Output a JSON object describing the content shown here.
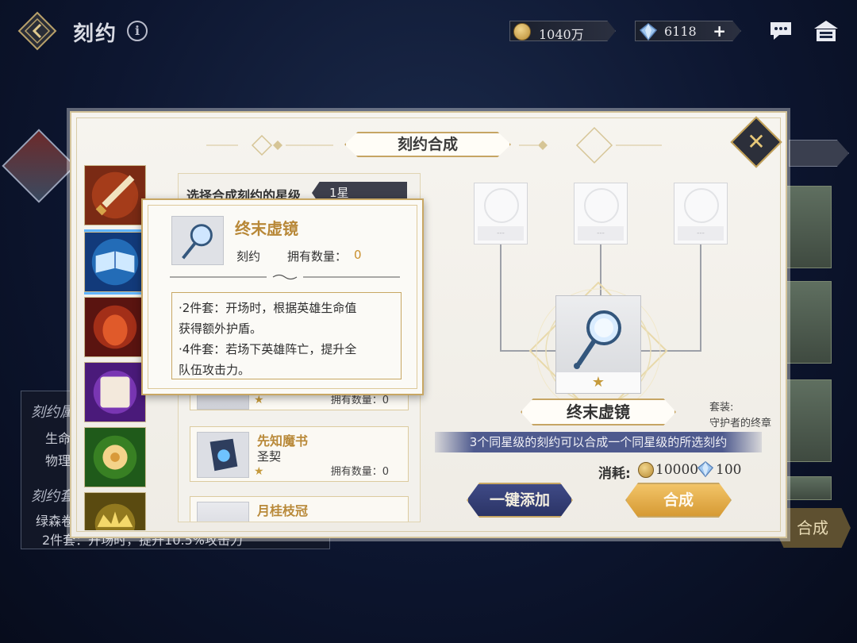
{
  "header": {
    "title": "刻约",
    "gold": "1040万",
    "gems": "6118",
    "icons": [
      "back-icon",
      "info-icon",
      "gold-coin-icon",
      "gem-icon",
      "plus-icon",
      "chat-icon",
      "home-icon"
    ]
  },
  "background": {
    "panel_title1": "刻约属",
    "panel_line1": "生命",
    "panel_line2": "物理",
    "panel_title2": "刻约套",
    "panel_line3": "绿森卷",
    "panel_line4": "2件套：开场时，提升10.5%攻击力",
    "hecheng_button": "合成"
  },
  "modal": {
    "title": "刻约合成",
    "close": "✕",
    "star_select_label": "选择合成刻约的星级",
    "star_select_value": "1星",
    "list": [
      {
        "name": "",
        "sub": "",
        "owned_label": "拥有数量：0",
        "stars": "★"
      },
      {
        "name": "先知魔书",
        "sub": "圣契",
        "owned_label": "拥有数量：0",
        "stars": "★"
      },
      {
        "name": "月桂枝冠",
        "sub": "",
        "owned_label": "",
        "stars": ""
      }
    ],
    "tooltip": {
      "name": "终末虚镜",
      "type": "刻约",
      "owned_label": "拥有数量：",
      "owned_value": "0",
      "desc_line1": "·2件套：开场时，根据英雄生命值",
      "desc_line2": "获得额外护盾。",
      "desc_line3": "·4件套：若场下英雄阵亡，提升全",
      "desc_line4": "队伍攻击力。"
    },
    "slots": [
      "---",
      "---",
      "---"
    ],
    "result": {
      "name": "终末虚镜",
      "stars": "★",
      "set_label": "套装:",
      "set_name": "守护者的终章"
    },
    "rule": "3个同星级的刻约可以合成一个同星级的所选刻约",
    "cost_label": "消耗:",
    "cost_gold": "10000",
    "cost_gems": "100",
    "auto_add_button": "一键添加",
    "synth_button": "合成"
  },
  "colors": {
    "accent_gold": "#c8a764",
    "banner_blue": "#4e5a8e",
    "synth_orange": "#e0a84a"
  }
}
